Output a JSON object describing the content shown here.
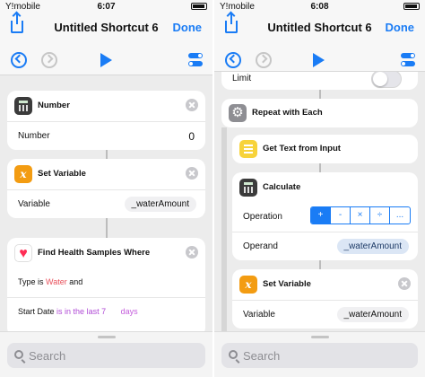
{
  "left": {
    "status": {
      "carrier": "Y!mobile",
      "time": "6:07"
    },
    "title": "Untitled Shortcut 6",
    "done": "Done",
    "number_card": {
      "title": "Number",
      "label": "Number",
      "value": "0"
    },
    "setvar_card": {
      "title": "Set Variable",
      "label": "Variable",
      "value": "_waterAmount"
    },
    "health_card": {
      "title": "Find Health Samples Where",
      "type_prefix": "Type is",
      "type_value": "Water",
      "type_suffix": "and",
      "date_prefix": "Start Date",
      "date_value": "is in the last",
      "date_num": "7",
      "date_unit": "days"
    },
    "search_placeholder": "Search"
  },
  "right": {
    "status": {
      "carrier": "Y!mobile",
      "time": "6:08"
    },
    "title": "Untitled Shortcut 6",
    "done": "Done",
    "limit_label": "Limit",
    "repeat_card": {
      "title": "Repeat with Each"
    },
    "gettext_card": {
      "title": "Get Text from Input"
    },
    "calc_card": {
      "title": "Calculate",
      "operation_label": "Operation",
      "operations": [
        "+",
        "-",
        "×",
        "÷",
        "..."
      ],
      "operand_label": "Operand",
      "operand_value": "_waterAmount"
    },
    "setvar_card": {
      "title": "Set Variable",
      "label": "Variable",
      "value": "_waterAmount"
    },
    "search_placeholder": "Search"
  },
  "colors": {
    "accent": "#1a7cf5",
    "background": "#ececec",
    "variable_icon": "#f39c12",
    "health_icon": "#ff2d55"
  },
  "icons": [
    "share-icon",
    "undo-icon",
    "redo-icon",
    "play-icon",
    "settings-toggles-icon",
    "close-icon",
    "search-icon",
    "calculator-icon",
    "variable-icon",
    "health-icon",
    "repeat-icon",
    "text-icon"
  ]
}
